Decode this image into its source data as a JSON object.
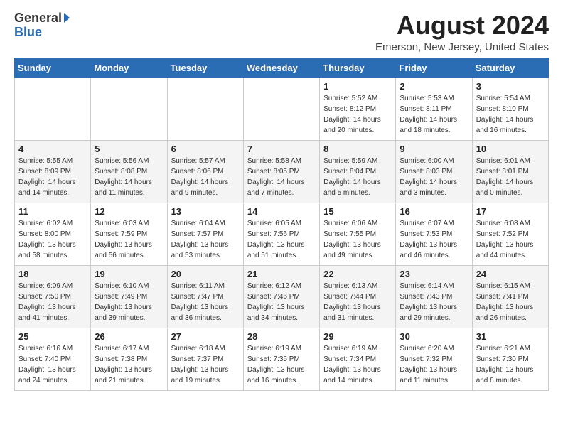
{
  "header": {
    "logo_general": "General",
    "logo_blue": "Blue",
    "main_title": "August 2024",
    "subtitle": "Emerson, New Jersey, United States"
  },
  "weekdays": [
    "Sunday",
    "Monday",
    "Tuesday",
    "Wednesday",
    "Thursday",
    "Friday",
    "Saturday"
  ],
  "weeks": [
    [
      {
        "day": "",
        "info": ""
      },
      {
        "day": "",
        "info": ""
      },
      {
        "day": "",
        "info": ""
      },
      {
        "day": "",
        "info": ""
      },
      {
        "day": "1",
        "info": "Sunrise: 5:52 AM\nSunset: 8:12 PM\nDaylight: 14 hours\nand 20 minutes."
      },
      {
        "day": "2",
        "info": "Sunrise: 5:53 AM\nSunset: 8:11 PM\nDaylight: 14 hours\nand 18 minutes."
      },
      {
        "day": "3",
        "info": "Sunrise: 5:54 AM\nSunset: 8:10 PM\nDaylight: 14 hours\nand 16 minutes."
      }
    ],
    [
      {
        "day": "4",
        "info": "Sunrise: 5:55 AM\nSunset: 8:09 PM\nDaylight: 14 hours\nand 14 minutes."
      },
      {
        "day": "5",
        "info": "Sunrise: 5:56 AM\nSunset: 8:08 PM\nDaylight: 14 hours\nand 11 minutes."
      },
      {
        "day": "6",
        "info": "Sunrise: 5:57 AM\nSunset: 8:06 PM\nDaylight: 14 hours\nand 9 minutes."
      },
      {
        "day": "7",
        "info": "Sunrise: 5:58 AM\nSunset: 8:05 PM\nDaylight: 14 hours\nand 7 minutes."
      },
      {
        "day": "8",
        "info": "Sunrise: 5:59 AM\nSunset: 8:04 PM\nDaylight: 14 hours\nand 5 minutes."
      },
      {
        "day": "9",
        "info": "Sunrise: 6:00 AM\nSunset: 8:03 PM\nDaylight: 14 hours\nand 3 minutes."
      },
      {
        "day": "10",
        "info": "Sunrise: 6:01 AM\nSunset: 8:01 PM\nDaylight: 14 hours\nand 0 minutes."
      }
    ],
    [
      {
        "day": "11",
        "info": "Sunrise: 6:02 AM\nSunset: 8:00 PM\nDaylight: 13 hours\nand 58 minutes."
      },
      {
        "day": "12",
        "info": "Sunrise: 6:03 AM\nSunset: 7:59 PM\nDaylight: 13 hours\nand 56 minutes."
      },
      {
        "day": "13",
        "info": "Sunrise: 6:04 AM\nSunset: 7:57 PM\nDaylight: 13 hours\nand 53 minutes."
      },
      {
        "day": "14",
        "info": "Sunrise: 6:05 AM\nSunset: 7:56 PM\nDaylight: 13 hours\nand 51 minutes."
      },
      {
        "day": "15",
        "info": "Sunrise: 6:06 AM\nSunset: 7:55 PM\nDaylight: 13 hours\nand 49 minutes."
      },
      {
        "day": "16",
        "info": "Sunrise: 6:07 AM\nSunset: 7:53 PM\nDaylight: 13 hours\nand 46 minutes."
      },
      {
        "day": "17",
        "info": "Sunrise: 6:08 AM\nSunset: 7:52 PM\nDaylight: 13 hours\nand 44 minutes."
      }
    ],
    [
      {
        "day": "18",
        "info": "Sunrise: 6:09 AM\nSunset: 7:50 PM\nDaylight: 13 hours\nand 41 minutes."
      },
      {
        "day": "19",
        "info": "Sunrise: 6:10 AM\nSunset: 7:49 PM\nDaylight: 13 hours\nand 39 minutes."
      },
      {
        "day": "20",
        "info": "Sunrise: 6:11 AM\nSunset: 7:47 PM\nDaylight: 13 hours\nand 36 minutes."
      },
      {
        "day": "21",
        "info": "Sunrise: 6:12 AM\nSunset: 7:46 PM\nDaylight: 13 hours\nand 34 minutes."
      },
      {
        "day": "22",
        "info": "Sunrise: 6:13 AM\nSunset: 7:44 PM\nDaylight: 13 hours\nand 31 minutes."
      },
      {
        "day": "23",
        "info": "Sunrise: 6:14 AM\nSunset: 7:43 PM\nDaylight: 13 hours\nand 29 minutes."
      },
      {
        "day": "24",
        "info": "Sunrise: 6:15 AM\nSunset: 7:41 PM\nDaylight: 13 hours\nand 26 minutes."
      }
    ],
    [
      {
        "day": "25",
        "info": "Sunrise: 6:16 AM\nSunset: 7:40 PM\nDaylight: 13 hours\nand 24 minutes."
      },
      {
        "day": "26",
        "info": "Sunrise: 6:17 AM\nSunset: 7:38 PM\nDaylight: 13 hours\nand 21 minutes."
      },
      {
        "day": "27",
        "info": "Sunrise: 6:18 AM\nSunset: 7:37 PM\nDaylight: 13 hours\nand 19 minutes."
      },
      {
        "day": "28",
        "info": "Sunrise: 6:19 AM\nSunset: 7:35 PM\nDaylight: 13 hours\nand 16 minutes."
      },
      {
        "day": "29",
        "info": "Sunrise: 6:19 AM\nSunset: 7:34 PM\nDaylight: 13 hours\nand 14 minutes."
      },
      {
        "day": "30",
        "info": "Sunrise: 6:20 AM\nSunset: 7:32 PM\nDaylight: 13 hours\nand 11 minutes."
      },
      {
        "day": "31",
        "info": "Sunrise: 6:21 AM\nSunset: 7:30 PM\nDaylight: 13 hours\nand 8 minutes."
      }
    ]
  ]
}
